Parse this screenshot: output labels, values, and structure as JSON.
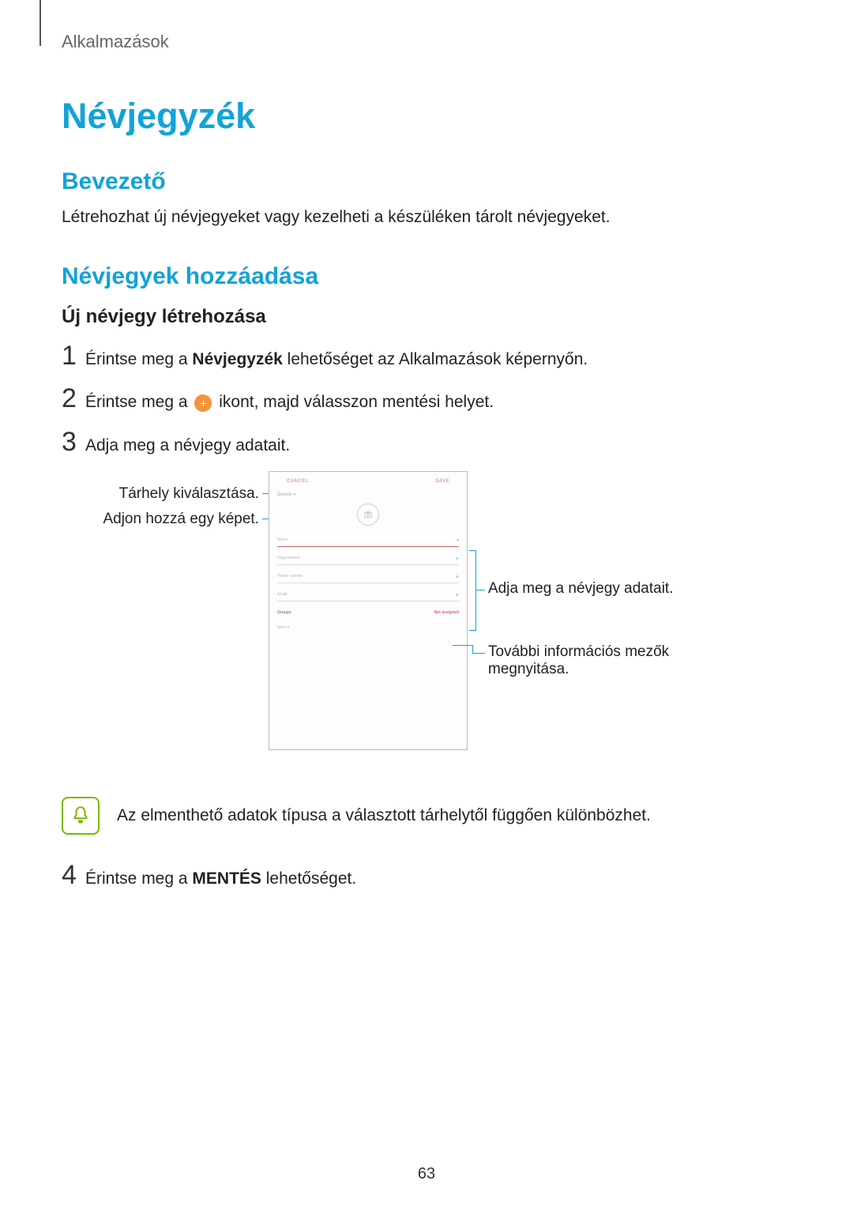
{
  "breadcrumb": "Alkalmazások",
  "title": "Névjegyzék",
  "section_intro": {
    "heading": "Bevezető",
    "text": "Létrehozhat új névjegyeket vagy kezelheti a készüléken tárolt névjegyeket."
  },
  "section_add": {
    "heading": "Névjegyek hozzáadása",
    "sub_heading": "Új névjegy létrehozása"
  },
  "steps": {
    "s1": {
      "num": "1",
      "pre": "Érintse meg a ",
      "bold": "Névjegyzék",
      "post": " lehetőséget az Alkalmazások képernyőn."
    },
    "s2": {
      "num": "2",
      "pre": "Érintse meg a ",
      "post": " ikont, majd válasszon mentési helyet."
    },
    "s3": {
      "num": "3",
      "text": "Adja meg a névjegy adatait."
    },
    "s4": {
      "num": "4",
      "pre": "Érintse meg a ",
      "bold": "MENTÉS",
      "post": " lehetőséget."
    }
  },
  "callouts": {
    "left1": "Tárhely kiválasztása.",
    "left2": "Adjon hozzá egy képet.",
    "right1": "Adja meg a névjegy adatait.",
    "right2": "További információs mezők megnyitása."
  },
  "mock": {
    "cancel": "CANCEL",
    "save": "SAVE",
    "storage": "Device",
    "name": "Name",
    "org": "Organisation",
    "phone": "Phone number",
    "email": "Email",
    "groups": "Groups",
    "not_assigned": "Not assigned",
    "more": "More"
  },
  "note": "Az elmenthető adatok típusa a választott tárhelytől függően különbözhet.",
  "page_number": "63"
}
